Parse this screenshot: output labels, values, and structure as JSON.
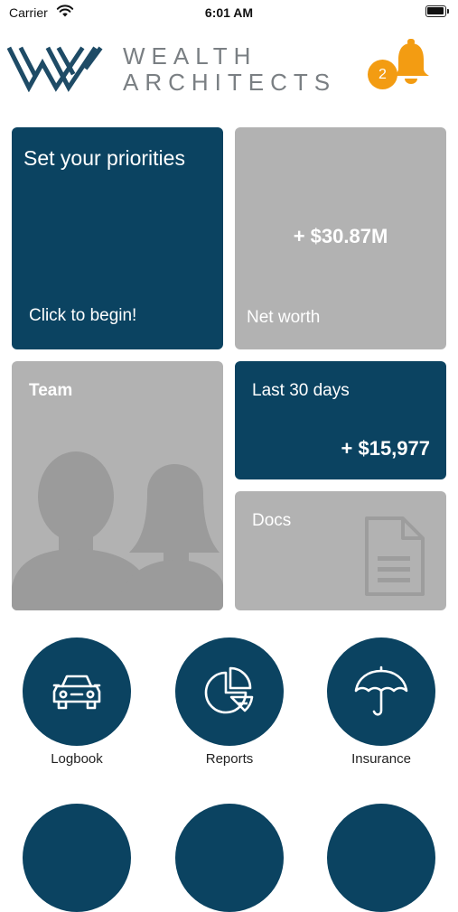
{
  "status_bar": {
    "carrier": "Carrier",
    "time": "6:01 AM"
  },
  "brand": {
    "line1": "WEALTH",
    "line2": "ARCHITECTS",
    "color": "#7a7f83"
  },
  "notifications": {
    "count": "2",
    "badge_color": "#f39c12",
    "icon": "bell-icon"
  },
  "tiles": {
    "priorities": {
      "title": "Set your priorities",
      "cta": "Click to begin!"
    },
    "net_worth": {
      "value": "+ $30.87M",
      "label": "Net worth"
    },
    "team": {
      "title": "Team"
    },
    "last_30_days": {
      "title": "Last 30 days",
      "value": "+ $15,977"
    },
    "docs": {
      "title": "Docs"
    }
  },
  "actions": [
    {
      "label": "Logbook",
      "icon": "car-icon"
    },
    {
      "label": "Reports",
      "icon": "pie-chart-icon"
    },
    {
      "label": "Insurance",
      "icon": "umbrella-icon"
    }
  ],
  "colors": {
    "primary": "#0b4361",
    "tile_grey": "#b2b2b2",
    "accent": "#f39c12"
  }
}
